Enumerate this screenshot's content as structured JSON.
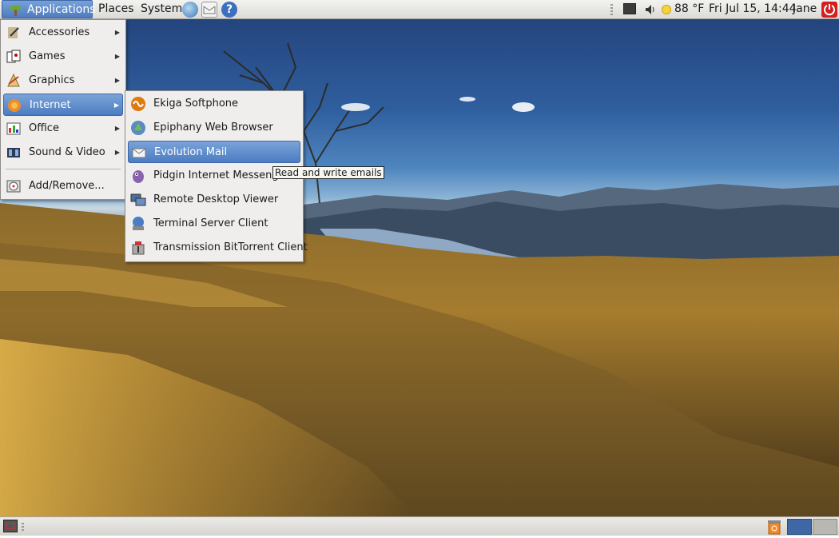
{
  "top_panel": {
    "applications_label": "Applications",
    "places_label": "Places",
    "system_label": "System",
    "launchers": [
      "web-browser-icon",
      "mail-icon",
      "help-icon"
    ],
    "tray": {
      "weather_temp": "88 °F",
      "clock": "Fri Jul 15, 14:44",
      "user": "Jane",
      "icons": [
        "network-icon",
        "volume-icon",
        "weather-sun-icon",
        "power-icon"
      ]
    }
  },
  "apps_menu": {
    "items": [
      {
        "label": "Accessories",
        "icon": "accessories-icon",
        "submenu": true
      },
      {
        "label": "Games",
        "icon": "games-icon",
        "submenu": true
      },
      {
        "label": "Graphics",
        "icon": "graphics-icon",
        "submenu": true
      },
      {
        "label": "Internet",
        "icon": "internet-icon",
        "submenu": true,
        "active": true
      },
      {
        "label": "Office",
        "icon": "office-icon",
        "submenu": true
      },
      {
        "label": "Sound & Video",
        "icon": "sound-video-icon",
        "submenu": true
      },
      {
        "label": "Add/Remove...",
        "icon": "add-remove-icon",
        "submenu": false
      }
    ]
  },
  "internet_submenu": {
    "items": [
      {
        "label": "Ekiga Softphone",
        "icon": "ekiga-icon"
      },
      {
        "label": "Epiphany Web Browser",
        "icon": "epiphany-icon"
      },
      {
        "label": "Evolution Mail",
        "icon": "evolution-icon",
        "active": true
      },
      {
        "label": "Pidgin Internet Messenger",
        "icon": "pidgin-icon"
      },
      {
        "label": "Remote Desktop Viewer",
        "icon": "remote-desktop-icon"
      },
      {
        "label": "Terminal Server Client",
        "icon": "terminal-server-icon"
      },
      {
        "label": "Transmission BitTorrent Client",
        "icon": "transmission-icon"
      }
    ]
  },
  "tooltip": "Read and write emails",
  "bottom_panel": {
    "icons": [
      "show-desktop-icon",
      "trash-icon"
    ],
    "workspaces": 2,
    "active_workspace": 1
  },
  "colors": {
    "selection": "#5684c7",
    "panel": "#e6e4df",
    "menu_bg": "#efeeec"
  }
}
